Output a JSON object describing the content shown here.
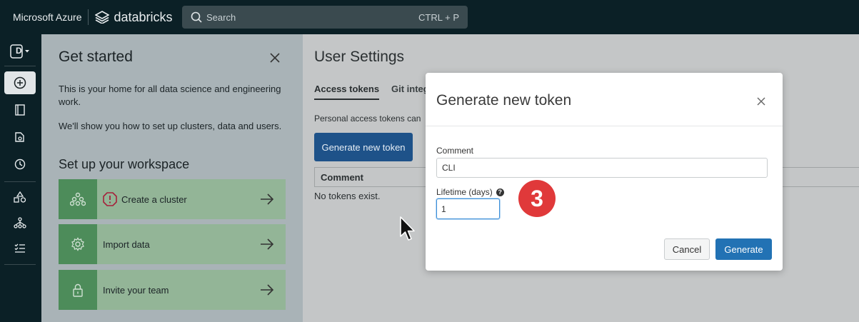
{
  "topbar": {
    "brand_ms": "Microsoft Azure",
    "brand_db": "databricks",
    "search_placeholder": "Search",
    "search_shortcut": "CTRL + P"
  },
  "rail": {
    "workspace_letter": "D",
    "items": [
      "new-icon",
      "notebook-icon",
      "data-icon",
      "recents-icon",
      "shapes-icon",
      "models-icon",
      "tasks-icon"
    ]
  },
  "get_started": {
    "title": "Get started",
    "intro": "This is your home for all data science and engineering work.",
    "intro2": "We'll show you how to set up clusters, data and users.",
    "section_title": "Set up your workspace",
    "tasks": [
      {
        "label": "Create a cluster",
        "icon": "cluster-icon"
      },
      {
        "label": "Import data",
        "icon": "gear-icon"
      },
      {
        "label": "Invite your team",
        "icon": "lock-icon"
      }
    ]
  },
  "user_settings": {
    "title": "User Settings",
    "tabs": [
      "Access tokens",
      "Git integ"
    ],
    "pat_text": "Personal access tokens can",
    "generate_button": "Generate new token",
    "table_header": "Comment",
    "empty_text": "No tokens exist."
  },
  "modal": {
    "title": "Generate new token",
    "comment_label": "Comment",
    "comment_value": "CLI",
    "lifetime_label": "Lifetime (days)",
    "lifetime_value": "1",
    "help_glyph": "?",
    "cancel": "Cancel",
    "generate": "Generate"
  },
  "annotation": {
    "step": "3",
    "color": "#e0393a"
  },
  "colors": {
    "accent": "#2272b4",
    "topbar": "#0b2026",
    "task_green": "#4d8c5a"
  }
}
